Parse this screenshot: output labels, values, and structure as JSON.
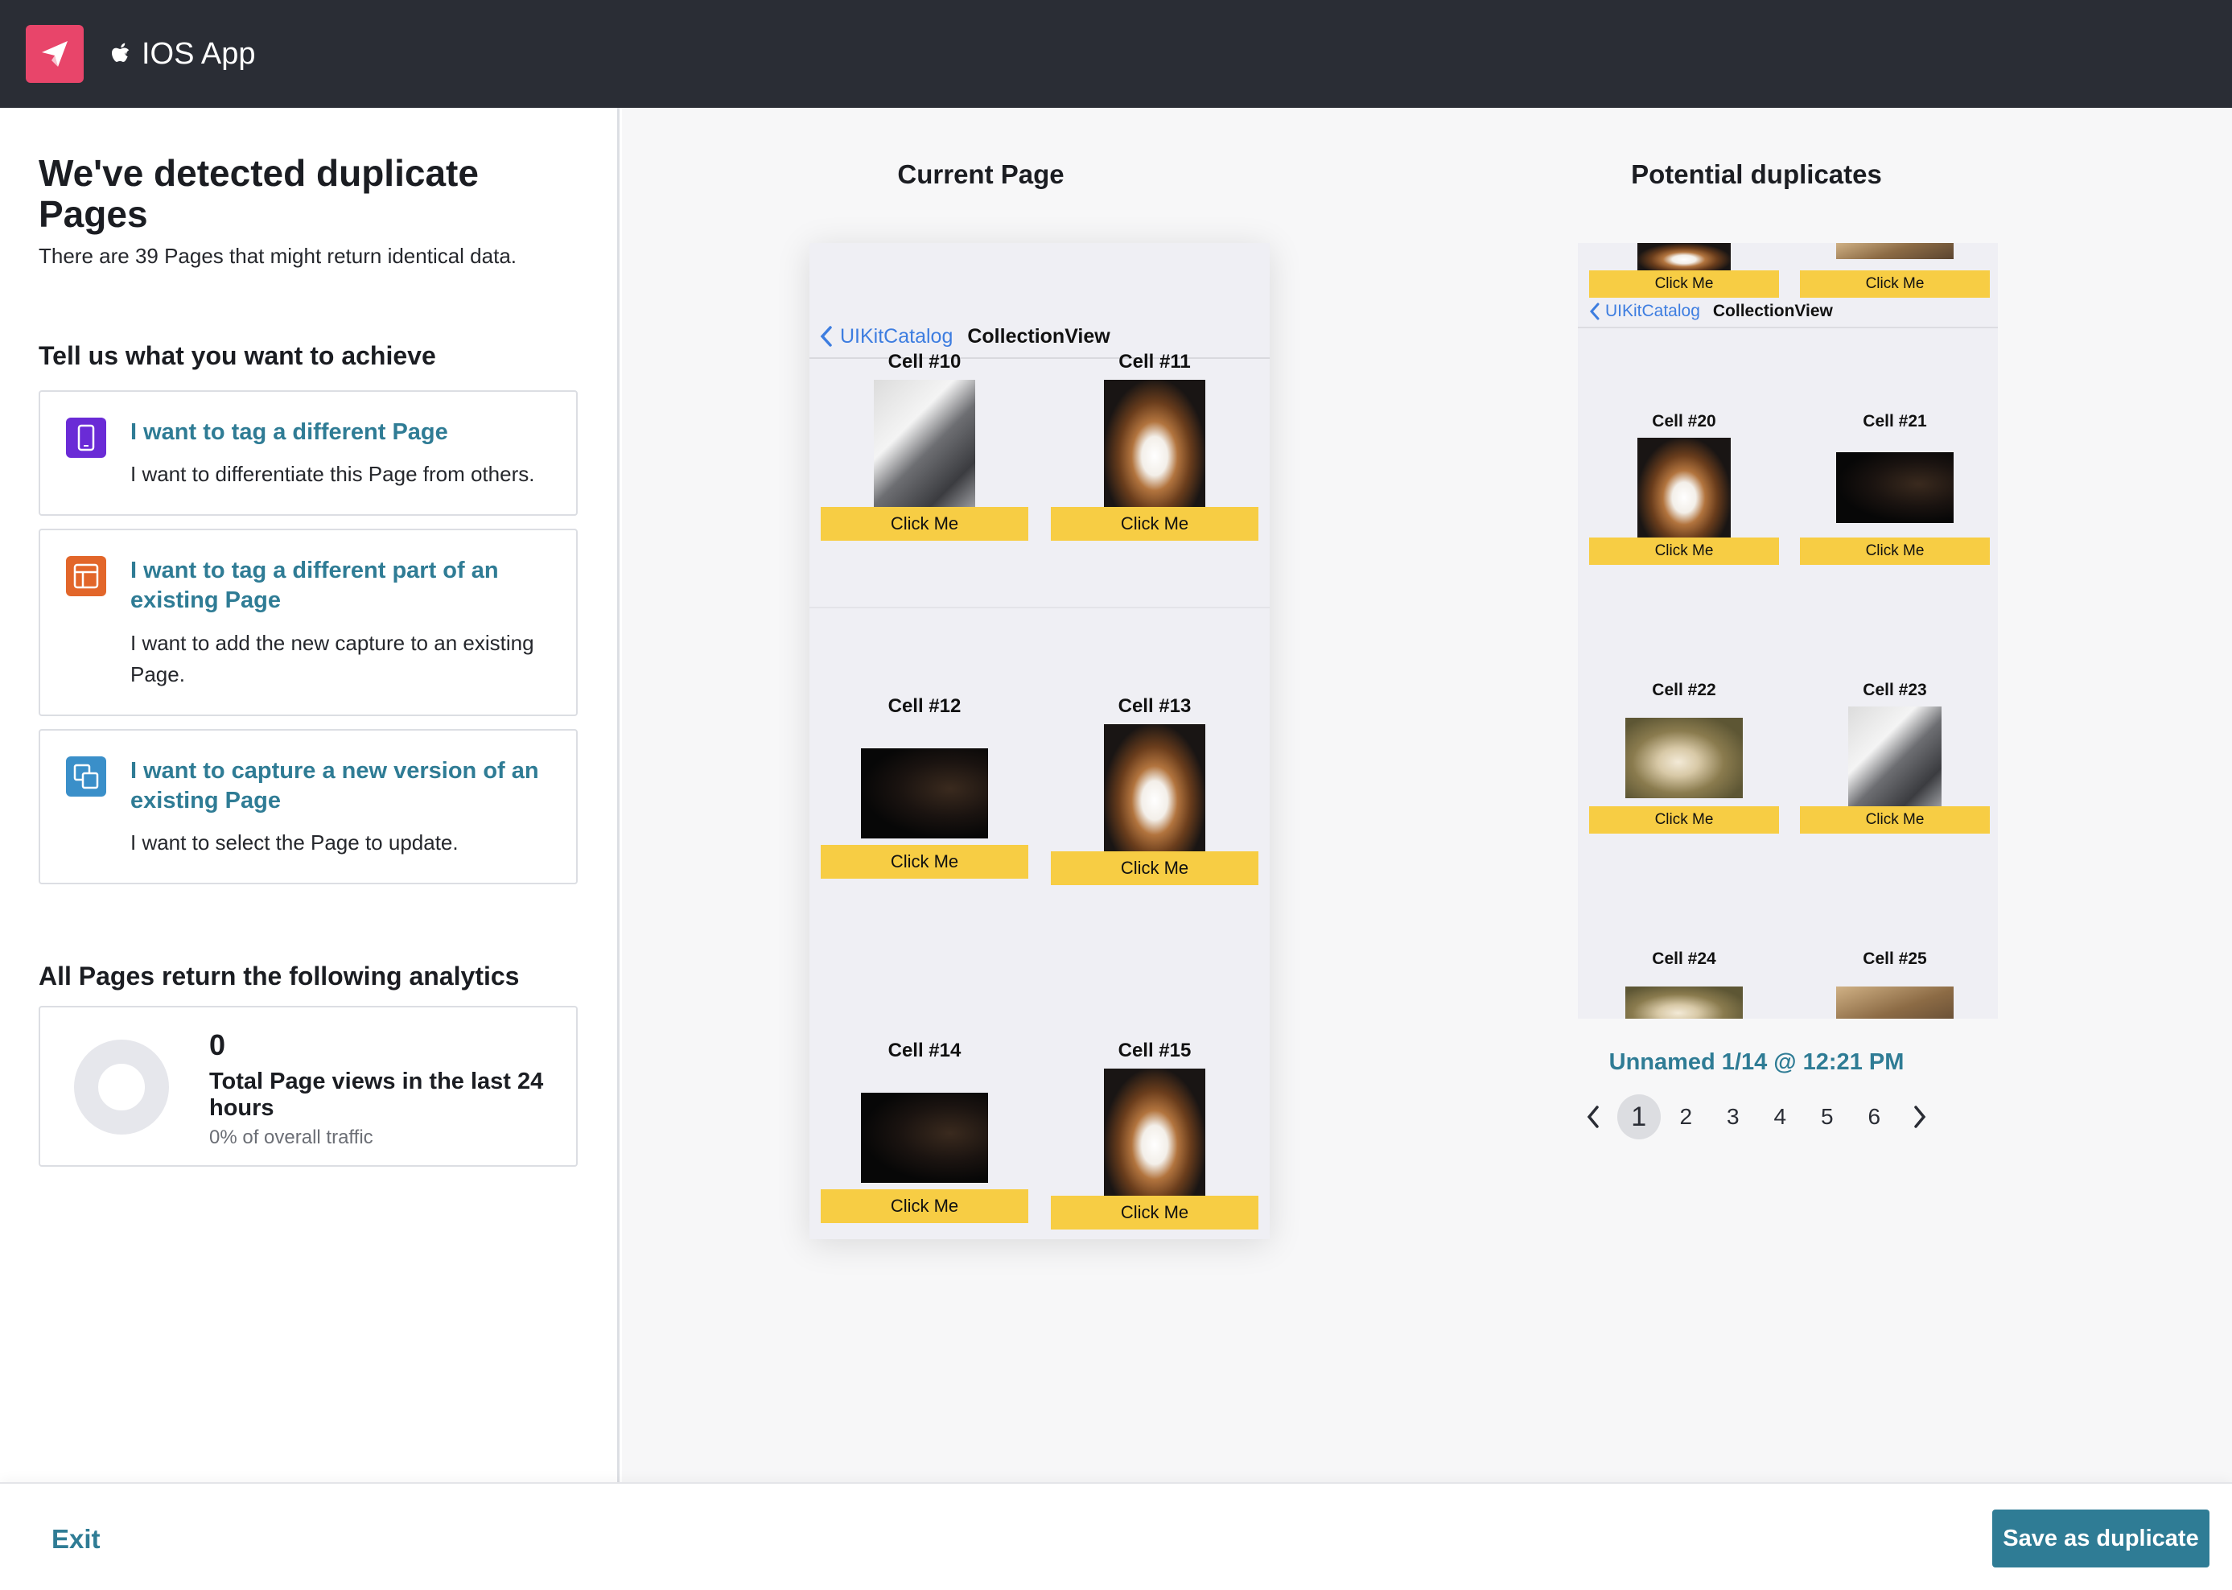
{
  "header": {
    "app_name": "IOS App",
    "logo_color": "#e8456a",
    "platform_icon": "apple-icon"
  },
  "left": {
    "title": "We've detected duplicate Pages",
    "subtitle": "There are 39 Pages that might return identical data.",
    "section_title": "Tell us what you want to achieve",
    "options": [
      {
        "title": "I want to tag a different Page",
        "desc": "I want to differentiate this Page from others.",
        "icon": "mobile-device-icon",
        "color": "#6a2bd6"
      },
      {
        "title": "I want to tag a different part of an existing Page",
        "desc": "I want to add the new capture to an existing Page.",
        "icon": "layout-icon",
        "color": "#e2662a"
      },
      {
        "title": "I want to capture a new version of an existing Page",
        "desc": "I want to select the Page to update.",
        "icon": "copy-icon",
        "color": "#3a8fc9"
      }
    ],
    "analytics_title": "All Pages return the following analytics",
    "analytics": {
      "value": "0",
      "label": "Total Page views in the last 24 hours",
      "sub": "0% of overall traffic"
    }
  },
  "main": {
    "current_title": "Current Page",
    "duplicates_title": "Potential duplicates",
    "current_phone": {
      "back_label": "UIKitCatalog",
      "nav_title": "CollectionView",
      "cells": [
        {
          "label": "Cell #10",
          "button": "Click Me"
        },
        {
          "label": "Cell #11",
          "button": "Click Me"
        },
        {
          "label": "Cell #12",
          "button": "Click Me"
        },
        {
          "label": "Cell #13",
          "button": "Click Me"
        },
        {
          "label": "Cell #14",
          "button": "Click Me"
        },
        {
          "label": "Cell #15",
          "button": "Click Me"
        }
      ]
    },
    "duplicate_phone": {
      "back_label": "UIKitCatalog",
      "nav_title": "CollectionView",
      "top_buttons": [
        "Click Me",
        "Click Me"
      ],
      "cells": [
        {
          "label": "Cell #20",
          "button": "Click Me"
        },
        {
          "label": "Cell #21",
          "button": "Click Me"
        },
        {
          "label": "Cell #22",
          "button": "Click Me"
        },
        {
          "label": "Cell #23",
          "button": "Click Me"
        },
        {
          "label": "Cell #24"
        },
        {
          "label": "Cell #25"
        }
      ]
    },
    "duplicate_name": "Unnamed 1/14 @ 12:21 PM",
    "pagination": {
      "pages": [
        "1",
        "2",
        "3",
        "4",
        "5",
        "6"
      ],
      "current": "1"
    }
  },
  "footer": {
    "exit_label": "Exit",
    "save_label": "Save as duplicate"
  }
}
